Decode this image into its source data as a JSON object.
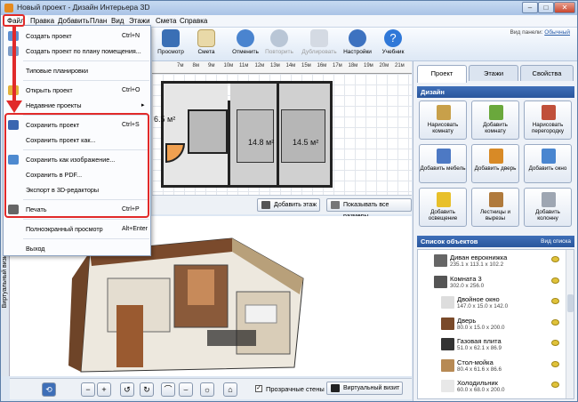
{
  "window": {
    "title": "Новый проект - Дизайн Интерьера 3D",
    "controls": [
      "–",
      "□",
      "✕"
    ]
  },
  "menubar": [
    "Файл",
    "Правка",
    "Добавить",
    "План",
    "Вид",
    "Этажи",
    "Смета",
    "Справка"
  ],
  "toolbar": {
    "buttons": [
      {
        "label": "Просмотр",
        "icon": "monitor-icon",
        "disabled": false
      },
      {
        "label": "Смета",
        "icon": "estimate-icon",
        "disabled": false
      },
      {
        "label": "Отменить",
        "icon": "undo-icon",
        "disabled": false
      },
      {
        "label": "Повторить",
        "icon": "redo-icon",
        "disabled": true
      },
      {
        "label": "Дублировать",
        "icon": "duplicate-icon",
        "disabled": true
      },
      {
        "label": "Настройки",
        "icon": "gear-icon",
        "disabled": false
      },
      {
        "label": "Учебник",
        "icon": "help-icon",
        "disabled": false
      }
    ],
    "panel_view_label": "Вид панели:",
    "panel_view_value": "Обычный"
  },
  "file_menu": [
    {
      "label": "Создать проект",
      "shortcut": "Ctrl+N",
      "icon": "new-project-icon"
    },
    {
      "label": "Создать проект по плану помещения...",
      "shortcut": "",
      "icon": "floorplan-import-icon"
    },
    {
      "sep": true
    },
    {
      "label": "Типовые планировки",
      "shortcut": "",
      "icon": ""
    },
    {
      "sep": true
    },
    {
      "label": "Открыть проект",
      "shortcut": "Ctrl+O",
      "icon": "open-folder-icon"
    },
    {
      "label": "Недавние проекты",
      "shortcut": "",
      "icon": "",
      "submenu": true
    },
    {
      "sep": true
    },
    {
      "label": "Сохранить проект",
      "shortcut": "Ctrl+S",
      "icon": "save-icon"
    },
    {
      "label": "Сохранить проект как...",
      "shortcut": "",
      "icon": ""
    },
    {
      "sep": true
    },
    {
      "label": "Сохранить как изображение...",
      "shortcut": "",
      "icon": "image-save-icon"
    },
    {
      "label": "Сохранить в  PDF...",
      "shortcut": "",
      "icon": ""
    },
    {
      "label": "Экспорт в 3D-редакторы",
      "shortcut": "",
      "icon": ""
    },
    {
      "sep": true
    },
    {
      "label": "Печать",
      "shortcut": "Ctrl+P",
      "icon": "printer-icon"
    },
    {
      "sep": true
    },
    {
      "label": "Полноэкранный просмотр",
      "shortcut": "Alt+Enter",
      "icon": ""
    },
    {
      "sep": true
    },
    {
      "label": "Выход",
      "shortcut": "",
      "icon": ""
    }
  ],
  "ruler": [
    "7м",
    "8м",
    "9м",
    "10м",
    "11м",
    "12м",
    "13м",
    "14м",
    "15м",
    "16м",
    "17м",
    "18м",
    "19м",
    "20м",
    "21м"
  ],
  "plan": {
    "rooms": [
      "6.5 м²",
      "14.8 м²",
      "14.5 м²"
    ],
    "add_floor": "Добавить этаж",
    "show_dims": "Показывать все размеры"
  },
  "view3d": {
    "side_tab": "Виртуальный визит",
    "transparent_walls": "Прозрачные стены",
    "virtual_visit": "Виртуальный визит"
  },
  "right_panel": {
    "tabs": [
      "Проект",
      "Этажи",
      "Свойства"
    ],
    "design_header": "Дизайн",
    "design_buttons": [
      {
        "label": "Нарисовать комнату",
        "icon": "draw-room-icon",
        "color": "#c8a04a"
      },
      {
        "label": "Добавить комнату",
        "icon": "add-room-icon",
        "color": "#6aa83c"
      },
      {
        "label": "Нарисовать перегородку",
        "icon": "brick-wall-icon",
        "color": "#c0503a"
      },
      {
        "label": "Добавить мебель",
        "icon": "furniture-icon",
        "color": "#4d79c4"
      },
      {
        "label": "Добавить дверь",
        "icon": "door-icon",
        "color": "#d88a26"
      },
      {
        "label": "Добавить окно",
        "icon": "window-icon",
        "color": "#4a86d0"
      },
      {
        "label": "Добавить освещение",
        "icon": "lamp-icon",
        "color": "#e8c02a"
      },
      {
        "label": "Лестницы и вырезы",
        "icon": "stairs-icon",
        "color": "#b07a3c"
      },
      {
        "label": "Добавить колонну",
        "icon": "column-icon",
        "color": "#9ea6b2"
      }
    ],
    "objects_header": "Список объектов",
    "objects_view": "Вид списка",
    "objects": [
      {
        "name": "Диван еврокнижка",
        "dims": "235.1 x 113.1 x 102.2",
        "indent": 0,
        "color": "#666666"
      },
      {
        "name": "Комната 3",
        "dims": "302.0 x 256.0",
        "indent": 0,
        "color": "#555555"
      },
      {
        "name": "Двойное окно",
        "dims": "147.0 x 15.0 x 142.0",
        "indent": 1,
        "color": "#dddddd"
      },
      {
        "name": "Дверь",
        "dims": "80.0 x 15.0 x 200.0",
        "indent": 1,
        "color": "#7a4a2a"
      },
      {
        "name": "Газовая плита",
        "dims": "51.0 x 62.1 x 86.9",
        "indent": 1,
        "color": "#333333"
      },
      {
        "name": "Стол-мойка",
        "dims": "80.4 x 61.6 x 86.6",
        "indent": 1,
        "color": "#b78a55"
      },
      {
        "name": "Холодильник",
        "dims": "60.0 x 68.0 x 200.0",
        "indent": 1,
        "color": "#e8e8e8"
      }
    ]
  }
}
